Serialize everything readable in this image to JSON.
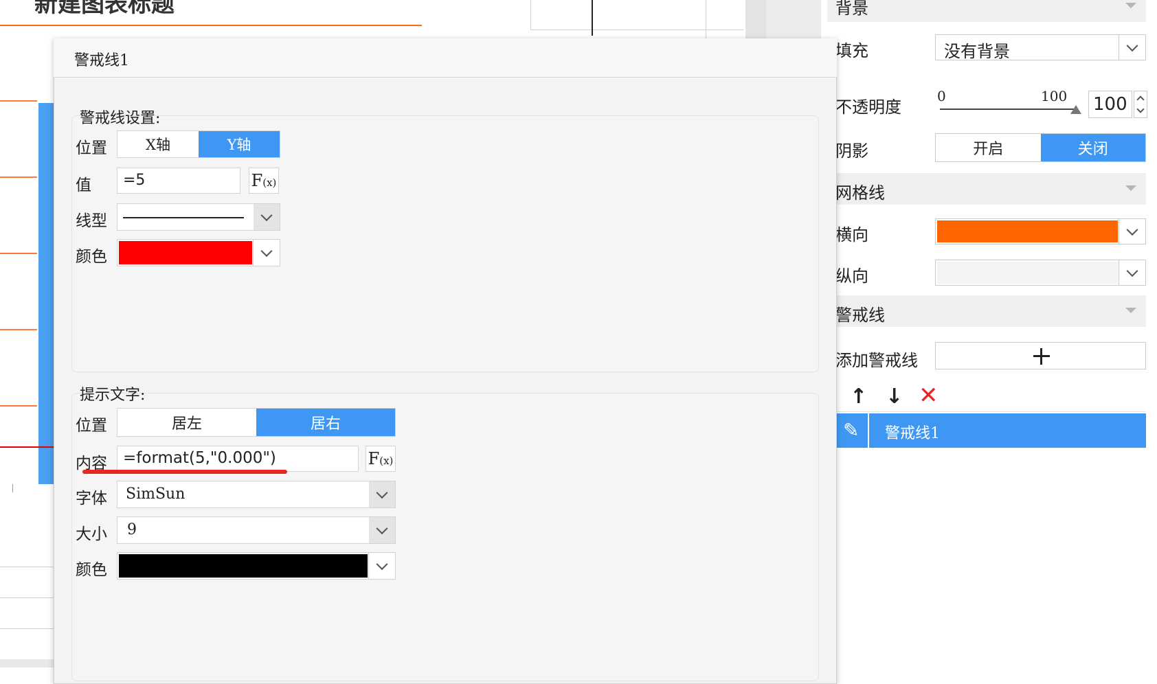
{
  "background_chart": {
    "title": "新建图表标题"
  },
  "dialog": {
    "title": "警戒线1",
    "line_settings": {
      "group_label": "警戒线设置:",
      "position_label": "位置",
      "position_options": [
        "X轴",
        "Y轴"
      ],
      "position_selected": "Y轴",
      "value_label": "值",
      "value": "=5",
      "fx_label": "F",
      "fx_sub": "(x)",
      "linetype_label": "线型",
      "color_label": "颜色",
      "color_value": "#ff0000"
    },
    "hint_text": {
      "group_label": "提示文字:",
      "position_label": "位置",
      "position_options": [
        "居左",
        "居右"
      ],
      "position_selected": "居右",
      "content_label": "内容",
      "content_value": "=format(5,\"0.000\")",
      "font_label": "字体",
      "font_value": "SimSun",
      "size_label": "大小",
      "size_value": "9",
      "color_label": "颜色",
      "color_value": "#000000",
      "annotation_color": "#e8281e"
    }
  },
  "right_panel": {
    "background_section": "背景",
    "fill_label": "填充",
    "fill_value": "没有背景",
    "opacity_label": "不透明度",
    "opacity_min": "0",
    "opacity_max": "100",
    "opacity_value": "100",
    "shadow_label": "阴影",
    "shadow_on": "开启",
    "shadow_off": "关闭",
    "shadow_selected": "关闭",
    "gridline_section": "网格线",
    "horizontal_label": "横向",
    "horizontal_color": "#ff6600",
    "vertical_label": "纵向",
    "alert_section": "警戒线",
    "add_alert_label": "添加警戒线",
    "add_icon": "plus-icon",
    "list_item": "警戒线1",
    "accent": "#3e98f3"
  }
}
